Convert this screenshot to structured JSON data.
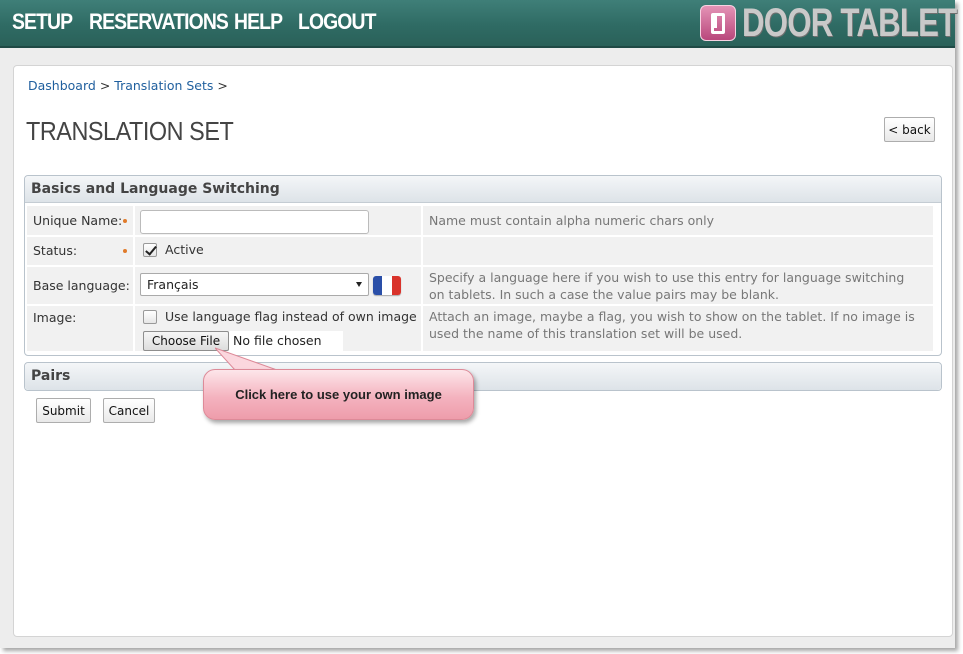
{
  "nav": {
    "items": [
      "SETUP",
      "RESERVATIONS",
      "HELP",
      "LOGOUT"
    ],
    "logo_text": "DOOR TABLET UI"
  },
  "breadcrumb": {
    "dashboard": "Dashboard",
    "sep1": ">",
    "translation_sets": "Translation Sets",
    "sep2": ">"
  },
  "page": {
    "title": "TRANSLATION SET",
    "back_label": "< back"
  },
  "sections": {
    "basics": {
      "title": "Basics and Language Switching",
      "unique_name": {
        "label": "Unique Name:",
        "value": "",
        "hint": "Name must contain alpha numeric chars only"
      },
      "status": {
        "label": "Status:",
        "checkbox_label": "Active",
        "checked": true
      },
      "base_language": {
        "label": "Base language:",
        "selected": "Français",
        "hint": "Specify a language here if you wish to use this entry for language switching on tablets. In such a case the value pairs may be blank."
      },
      "image": {
        "label": "Image:",
        "flag_checkbox_label": "Use language flag instead of own image",
        "flag_checked": false,
        "choose_file_label": "Choose File",
        "file_status": "No file chosen",
        "hint": "Attach an image, maybe a flag, you wish to show on the tablet. If no image is used the name of this translation set will be used."
      }
    },
    "pairs": {
      "title": "Pairs"
    }
  },
  "actions": {
    "submit_label": "Submit",
    "cancel_label": "Cancel"
  },
  "callout": {
    "text": "Click here to use your own image"
  },
  "colors": {
    "navbar": "#2f6b64",
    "link": "#1f5f9e",
    "required_dot": "#e07b2a",
    "callout": "#f4b3bf",
    "flag_blue": "#2a4fa8",
    "flag_white": "#ffffff",
    "flag_red": "#d9332b"
  },
  "icons": [
    "logo-tablet-icon",
    "french-flag-icon",
    "checkmark-icon",
    "dropdown-caret-icon"
  ]
}
